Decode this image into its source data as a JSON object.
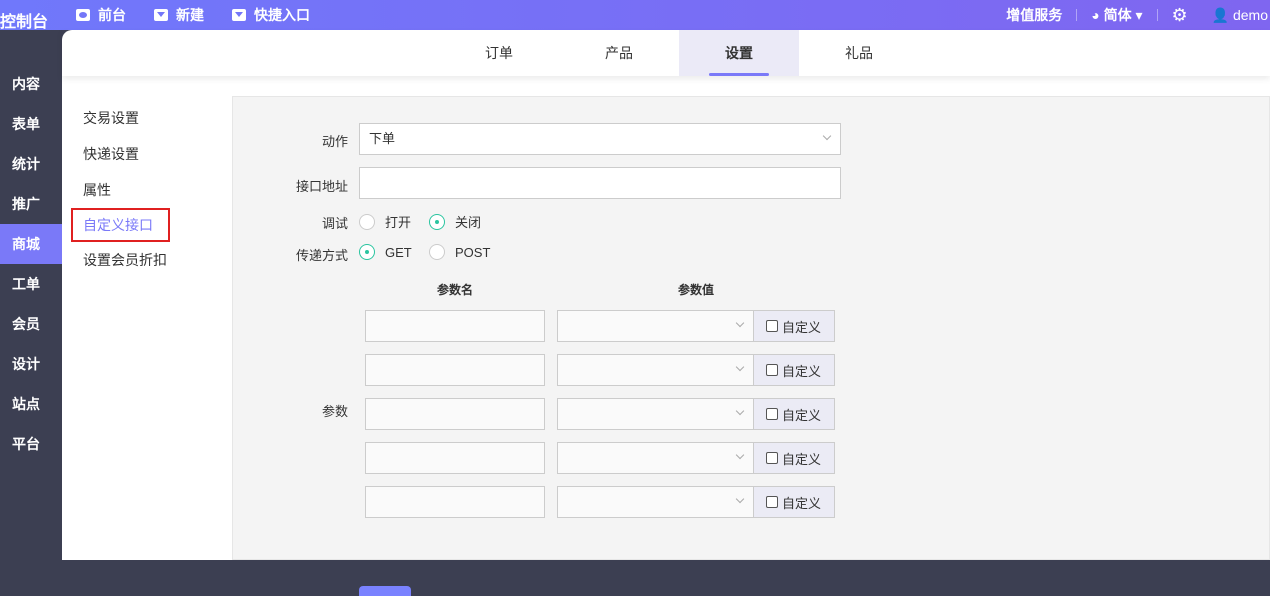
{
  "header": {
    "logo": "控制台",
    "nav": [
      "前台",
      "新建",
      "快捷入口"
    ],
    "value_added": "增值服务",
    "language": "简体",
    "user": "demo"
  },
  "sidebar": {
    "items": [
      "内容",
      "表单",
      "统计",
      "推广",
      "商城",
      "工单",
      "会员",
      "设计",
      "站点",
      "平台"
    ],
    "active": "商城"
  },
  "tabs": [
    "订单",
    "产品",
    "设置",
    "礼品"
  ],
  "active_tab": "设置",
  "submenu": [
    "交易设置",
    "快递设置",
    "属性",
    "自定义接口",
    "设置会员折扣"
  ],
  "form": {
    "action_label": "动作",
    "action_value": "下单",
    "api_label": "接口地址",
    "api_value": "",
    "debug_label": "调试",
    "debug_options": [
      "打开",
      "关闭"
    ],
    "debug_selected": "关闭",
    "method_label": "传递方式",
    "method_options": [
      "GET",
      "POST"
    ],
    "method_selected": "GET",
    "param_name_header": "参数名",
    "param_value_header": "参数值",
    "params_label": "参数",
    "custom_label": "自定义"
  },
  "colors": {
    "accent": "#7a79f8",
    "radio": "#2bc5a0"
  }
}
